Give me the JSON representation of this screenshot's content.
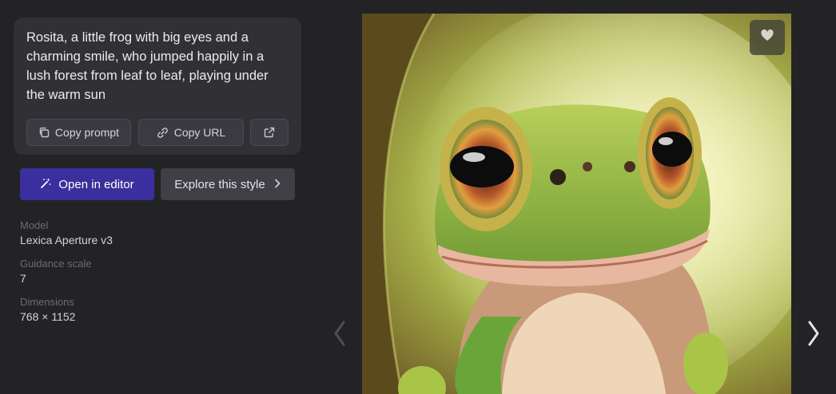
{
  "prompt": {
    "text": "Rosita, a little frog with big eyes and a charming smile, who jumped happily in a lush forest from leaf to leaf, playing under the warm sun"
  },
  "actions": {
    "copy_prompt_label": "Copy prompt",
    "copy_url_label": "Copy URL",
    "open_editor_label": "Open in editor",
    "explore_style_label": "Explore this style"
  },
  "details": {
    "model_label": "Model",
    "model_value": "Lexica Aperture v3",
    "guidance_label": "Guidance scale",
    "guidance_value": "7",
    "dimensions_label": "Dimensions",
    "dimensions_value": "768 × 1152"
  },
  "icons": {
    "copy": "copy-icon",
    "link": "link-icon",
    "external": "external-link-icon",
    "wand": "magic-wand-icon",
    "chevron": "chevron-right-icon",
    "heart": "heart-icon",
    "prev": "chevron-left-icon",
    "next": "chevron-right-icon"
  },
  "colors": {
    "background": "#232326",
    "card": "#303035",
    "primary_button": "#3b2fa0",
    "secondary_button": "#3f3f45"
  }
}
